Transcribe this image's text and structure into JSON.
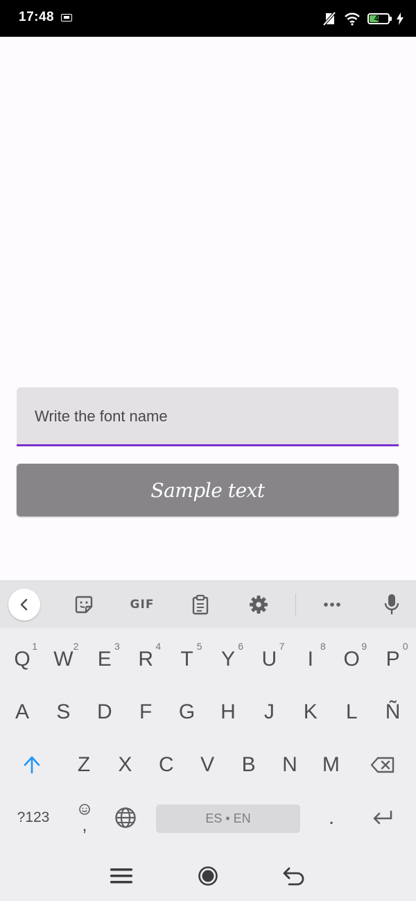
{
  "status_bar": {
    "time": "17:48",
    "battery_level": "49"
  },
  "field": {
    "placeholder": "Write the font name",
    "value": ""
  },
  "sample_button": {
    "label": "Sample text"
  },
  "keyboard": {
    "toolbar": {
      "gif_label": "GIF"
    },
    "row1": [
      {
        "label": "Q",
        "hint": "1"
      },
      {
        "label": "W",
        "hint": "2"
      },
      {
        "label": "E",
        "hint": "3"
      },
      {
        "label": "R",
        "hint": "4"
      },
      {
        "label": "T",
        "hint": "5"
      },
      {
        "label": "Y",
        "hint": "6"
      },
      {
        "label": "U",
        "hint": "7"
      },
      {
        "label": "I",
        "hint": "8"
      },
      {
        "label": "O",
        "hint": "9"
      },
      {
        "label": "P",
        "hint": "0"
      }
    ],
    "row2": [
      "A",
      "S",
      "D",
      "F",
      "G",
      "H",
      "J",
      "K",
      "L",
      "Ñ"
    ],
    "row3": [
      "Z",
      "X",
      "C",
      "V",
      "B",
      "N",
      "M"
    ],
    "symbols_label": "?123",
    "comma_label": ",",
    "space_label": "ES • EN",
    "period_label": "."
  },
  "colors": {
    "accent": "#7a2fd0",
    "button_bg": "#878588",
    "field_bg": "#e3e1e4",
    "shift_blue": "#2196f3"
  }
}
